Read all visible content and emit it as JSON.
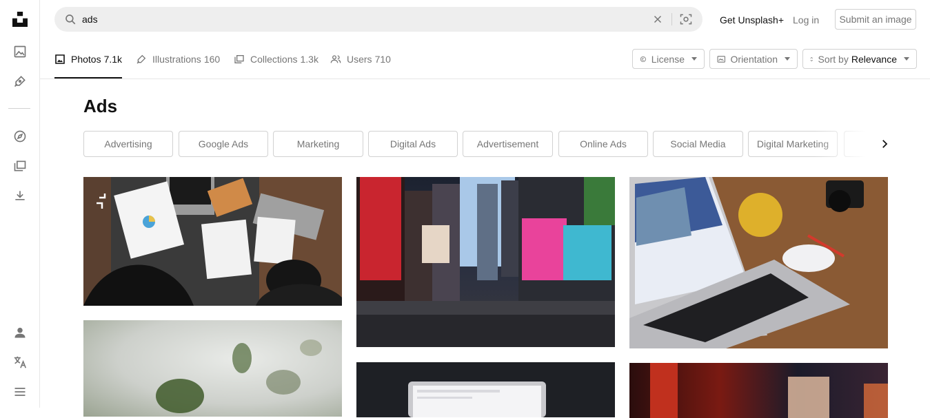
{
  "rail": {
    "icons": [
      "unsplash-logo-icon",
      "photo-icon",
      "illustration-pen-icon",
      "compass-icon",
      "collections-icon",
      "download-icon",
      "user-icon",
      "translate-icon",
      "menu-icon"
    ]
  },
  "search": {
    "value": "ads",
    "placeholder": "Search photos and illustrations"
  },
  "header": {
    "get_plus": "Get Unsplash+",
    "login": "Log in",
    "submit": "Submit an image"
  },
  "tabs": [
    {
      "label": "Photos",
      "count": "7.1k",
      "icon": "photo-icon"
    },
    {
      "label": "Illustrations",
      "count": "160",
      "icon": "pen-icon"
    },
    {
      "label": "Collections",
      "count": "1.3k",
      "icon": "collections-icon"
    },
    {
      "label": "Users",
      "count": "710",
      "icon": "users-icon"
    }
  ],
  "filters": {
    "license": "License",
    "orientation": "Orientation",
    "sort_prefix": "Sort by",
    "sort_value": "Relevance"
  },
  "page_title": "Ads",
  "chips": [
    "Advertising",
    "Google Ads",
    "Marketing",
    "Digital Ads",
    "Advertisement",
    "Online Ads",
    "Social Media",
    "Digital Marketing"
  ],
  "colors": {
    "text": "#111111",
    "muted": "#767676",
    "border": "#d1d1d1",
    "search_bg": "#eeeeee"
  }
}
